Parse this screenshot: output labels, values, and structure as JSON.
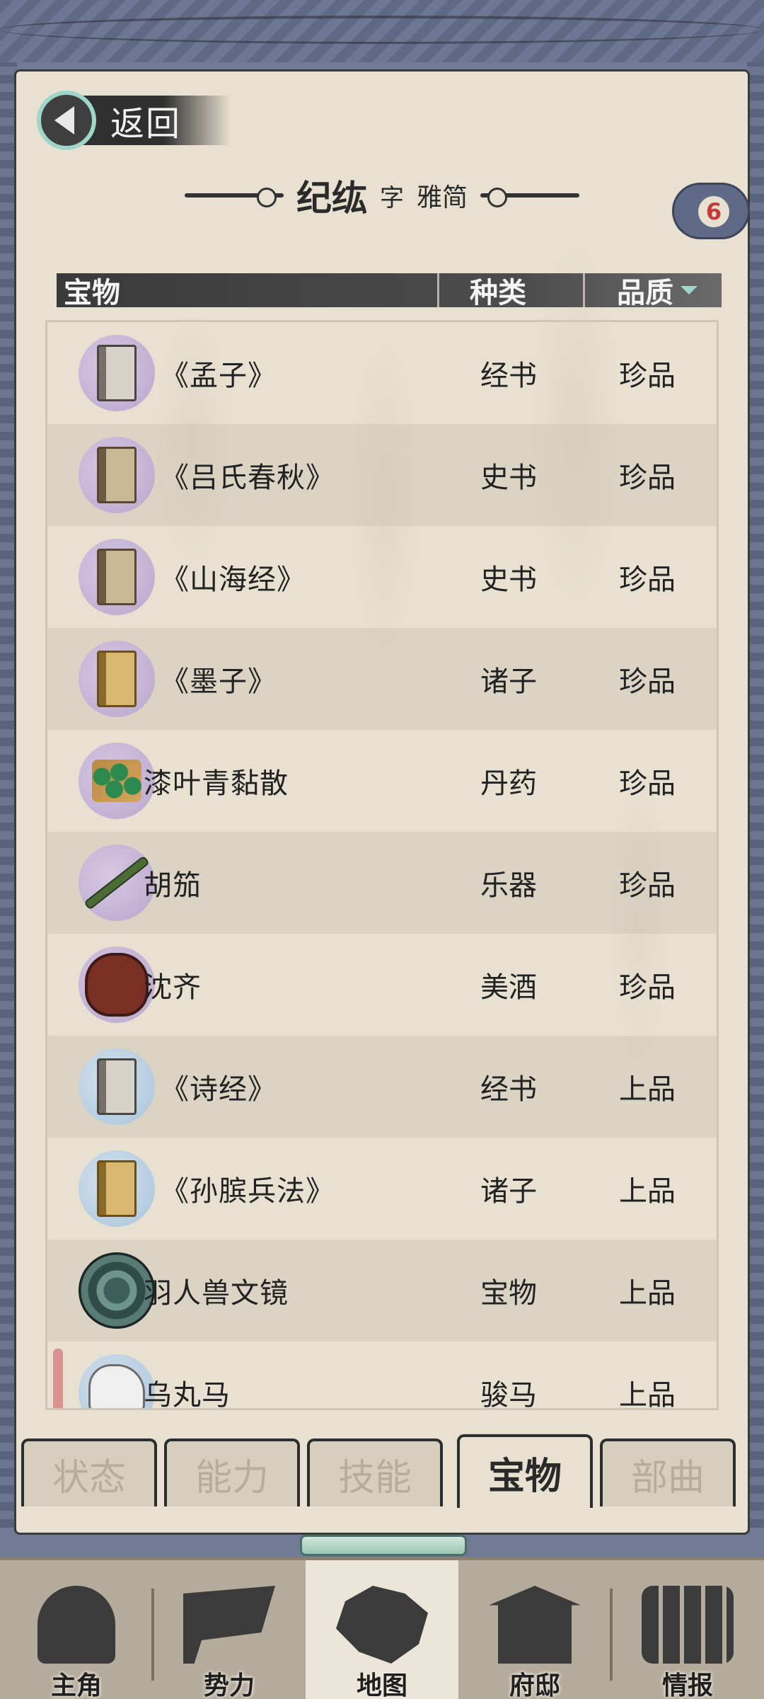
{
  "header": {
    "back_label": "返回",
    "character_name": "纪纮",
    "zi_label": "字",
    "style_name": "雅简",
    "badge_count": "6"
  },
  "table": {
    "columns": {
      "name": "宝物",
      "kind": "种类",
      "quality": "品质"
    },
    "sort_icon": "triangle-down-icon",
    "rows": [
      {
        "icon": "book-grey-icon",
        "name": "《孟子》",
        "kind": "经书",
        "quality": "珍品"
      },
      {
        "icon": "book-brown-icon",
        "name": "《吕氏春秋》",
        "kind": "史书",
        "quality": "珍品"
      },
      {
        "icon": "book-brown-icon",
        "name": "《山海经》",
        "kind": "史书",
        "quality": "珍品"
      },
      {
        "icon": "book-yellow-icon",
        "name": "《墨子》",
        "kind": "诸子",
        "quality": "珍品"
      },
      {
        "icon": "medicine-pills-icon",
        "name": "漆叶青黏散",
        "kind": "丹药",
        "quality": "珍品"
      },
      {
        "icon": "flute-icon",
        "name": "胡笳",
        "kind": "乐器",
        "quality": "珍品"
      },
      {
        "icon": "wine-jar-icon",
        "name": "沈齐",
        "kind": "美酒",
        "quality": "珍品"
      },
      {
        "icon": "book-grey-icon",
        "name": "《诗经》",
        "kind": "经书",
        "quality": "上品"
      },
      {
        "icon": "book-yellow-icon",
        "name": "《孙膑兵法》",
        "kind": "诸子",
        "quality": "上品"
      },
      {
        "icon": "bronze-mirror-icon",
        "name": "羽人兽文镜",
        "kind": "宝物",
        "quality": "上品"
      },
      {
        "icon": "horse-icon",
        "name": "乌丸马",
        "kind": "骏马",
        "quality": "上品"
      }
    ]
  },
  "subtabs": [
    {
      "label": "状态",
      "active": false
    },
    {
      "label": "能力",
      "active": false
    },
    {
      "label": "技能",
      "active": false
    },
    {
      "label": "宝物",
      "active": true
    },
    {
      "label": "部曲",
      "active": false
    }
  ],
  "bottom_nav": [
    {
      "label": "主角",
      "icon": "hero-icon"
    },
    {
      "label": "势力",
      "icon": "flag-icon"
    },
    {
      "label": "地图",
      "icon": "map-icon",
      "active": true
    },
    {
      "label": "府邸",
      "icon": "mansion-icon"
    },
    {
      "label": "情报",
      "icon": "scroll-icon"
    }
  ]
}
